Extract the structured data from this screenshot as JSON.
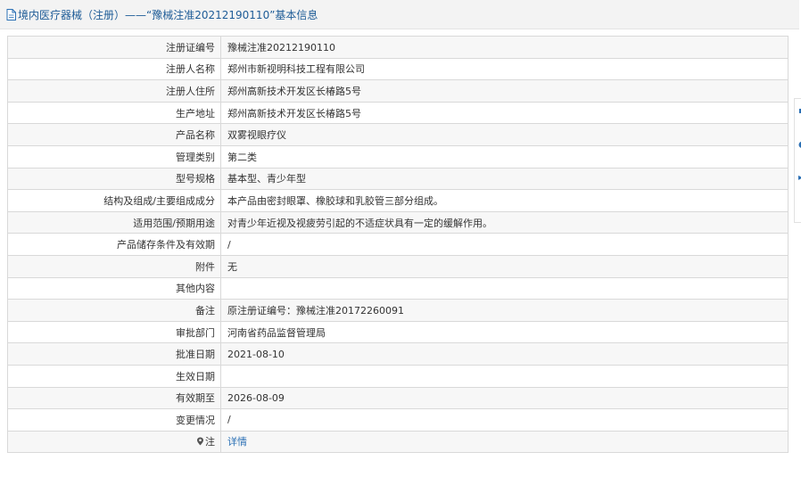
{
  "header": {
    "title": "境内医疗器械（注册）——“豫械注准20212190110”基本信息"
  },
  "rows": [
    {
      "label": "注册证编号",
      "value": "豫械注准20212190110"
    },
    {
      "label": "注册人名称",
      "value": "郑州市新视明科技工程有限公司"
    },
    {
      "label": "注册人住所",
      "value": "郑州高新技术开发区长椿路5号"
    },
    {
      "label": "生产地址",
      "value": "郑州高新技术开发区长椿路5号"
    },
    {
      "label": "产品名称",
      "value": "双雾视眼疗仪"
    },
    {
      "label": "管理类别",
      "value": "第二类"
    },
    {
      "label": "型号规格",
      "value": "基本型、青少年型"
    },
    {
      "label": "结构及组成/主要组成成分",
      "value": "本产品由密封眼罩、橡胶球和乳胶管三部分组成。"
    },
    {
      "label": "适用范围/预期用途",
      "value": "对青少年近视及视疲劳引起的不适症状具有一定的缓解作用。"
    },
    {
      "label": "产品储存条件及有效期",
      "value": "/"
    },
    {
      "label": "附件",
      "value": "无"
    },
    {
      "label": "其他内容",
      "value": ""
    },
    {
      "label": "备注",
      "value": "原注册证编号：豫械注准20172260091"
    },
    {
      "label": "审批部门",
      "value": "河南省药品监督管理局"
    },
    {
      "label": "批准日期",
      "value": "2021-08-10"
    },
    {
      "label": "生效日期",
      "value": ""
    },
    {
      "label": "有效期至",
      "value": "2026-08-09"
    },
    {
      "label": "变更情况",
      "value": "/"
    },
    {
      "label": "注",
      "value": "详情"
    }
  ],
  "icons": {
    "header": "document-icon",
    "note": "map-pin-icon"
  },
  "colors": {
    "title_text": "#1e5c97",
    "link_text": "#2a6fb4",
    "header_bg": "#f3f3f3"
  }
}
